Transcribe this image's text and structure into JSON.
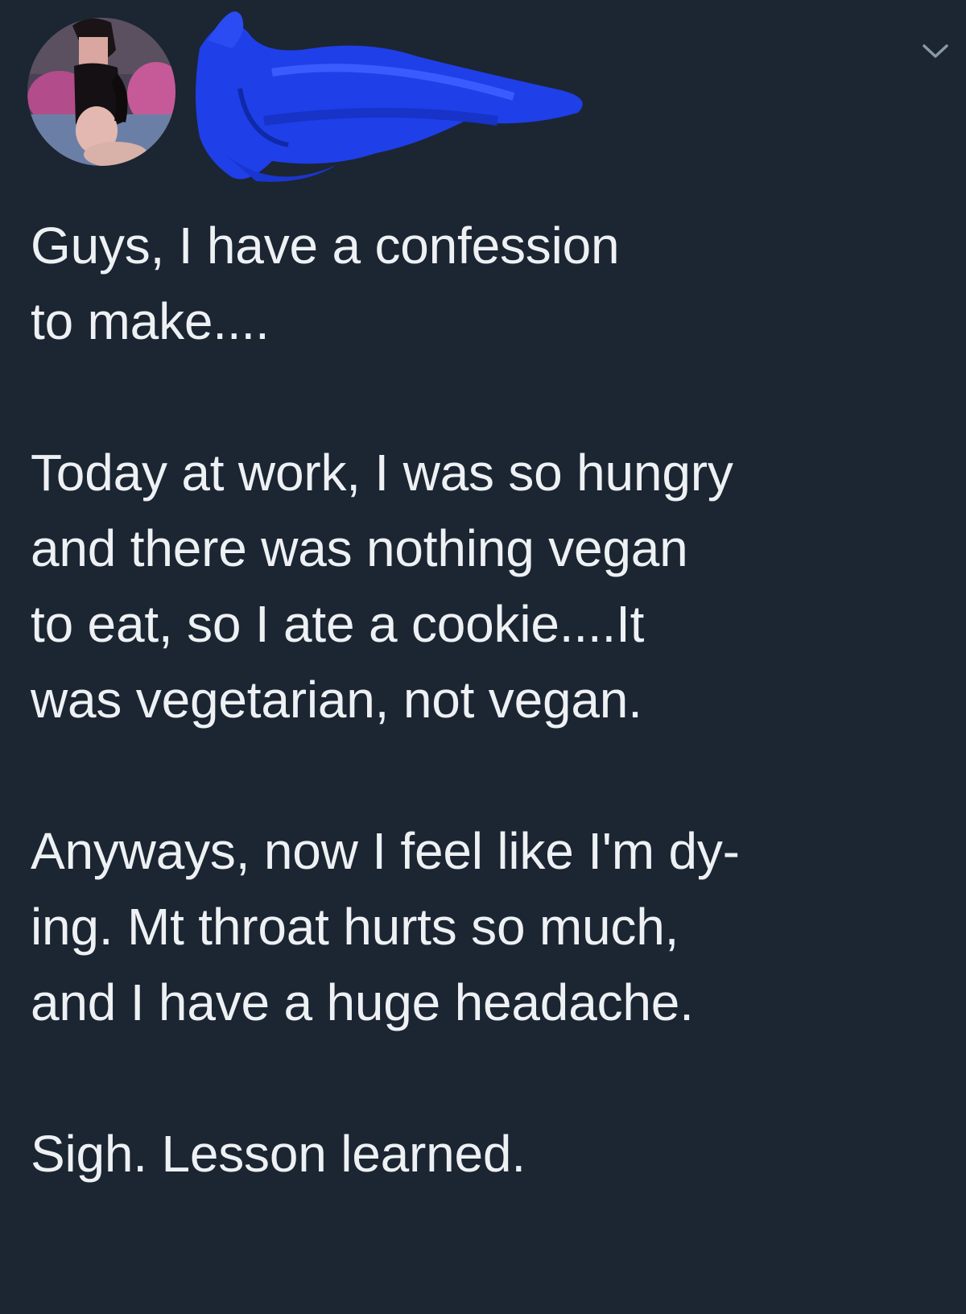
{
  "colors": {
    "background": "#1c2532",
    "text": "#eef1f4",
    "redaction_scribble": "#1f3fe8",
    "caret": "#8899a6"
  },
  "header": {
    "avatar_icon": "user-avatar",
    "name_redaction_icon": "blue-scribble-redaction",
    "menu_icon": "chevron-down-icon"
  },
  "tweet": {
    "paragraphs": [
      {
        "lines": [
          "Guys, I have a confession",
          "to make...."
        ]
      },
      {
        "lines": [
          "Today at work, I was so hungry",
          "and there was nothing vegan",
          "to eat, so I ate a cookie....It",
          "was vegetarian, not vegan."
        ]
      },
      {
        "lines": [
          "Anyways, now I feel like I'm dy-",
          "ing. Mt throat hurts so much,",
          "and I have a huge headache."
        ]
      },
      {
        "lines": [
          "Sigh. Lesson learned."
        ]
      }
    ]
  }
}
